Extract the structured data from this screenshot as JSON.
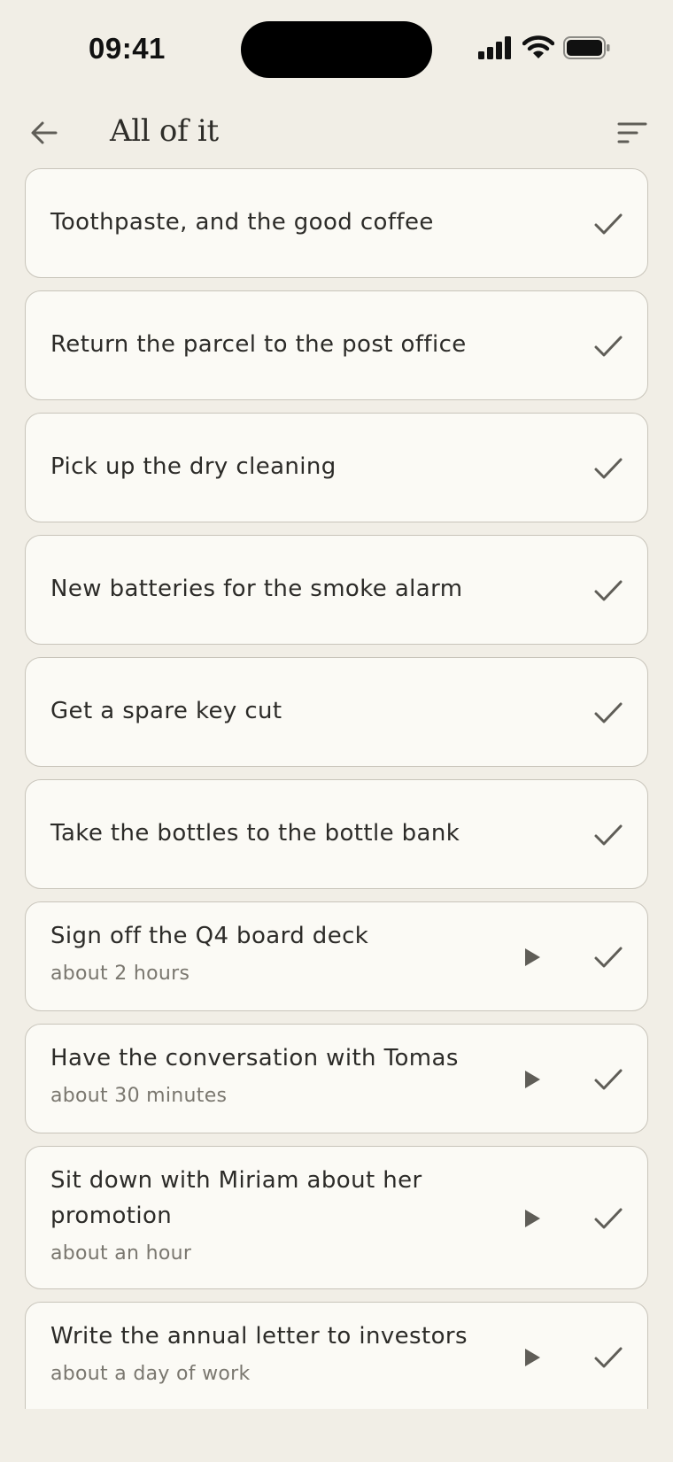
{
  "status_bar": {
    "time": "09:41",
    "icons": [
      "cellular-signal-icon",
      "wifi-icon",
      "battery-icon"
    ]
  },
  "header": {
    "title": "All of it",
    "back_icon": "arrow-left-icon",
    "sort_icon": "sort-lines-icon"
  },
  "tasks": [
    {
      "label": "Toothpaste, and the good coffee"
    },
    {
      "label": "Return the parcel to the post office"
    },
    {
      "label": "Pick up the dry cleaning"
    },
    {
      "label": "New batteries for the smoke alarm"
    },
    {
      "label": "Get a spare key cut"
    },
    {
      "label": "Take the bottles to the bottle bank"
    },
    {
      "label": "Sign off the Q4 board deck",
      "duration": "about 2 hours"
    },
    {
      "label": "Have the conversation with Tomas",
      "duration": "about 30 minutes"
    },
    {
      "label": "Sit down with Miriam about her promotion",
      "duration": "about an hour"
    },
    {
      "label": "Write the annual letter to investors",
      "duration": "about a day of work"
    }
  ],
  "colors": {
    "background": "#f1eee6",
    "card": "#fbfaf5",
    "card_border": "#c8c4ba",
    "icon": "#5f5d57",
    "subtext": "#7a776f"
  }
}
